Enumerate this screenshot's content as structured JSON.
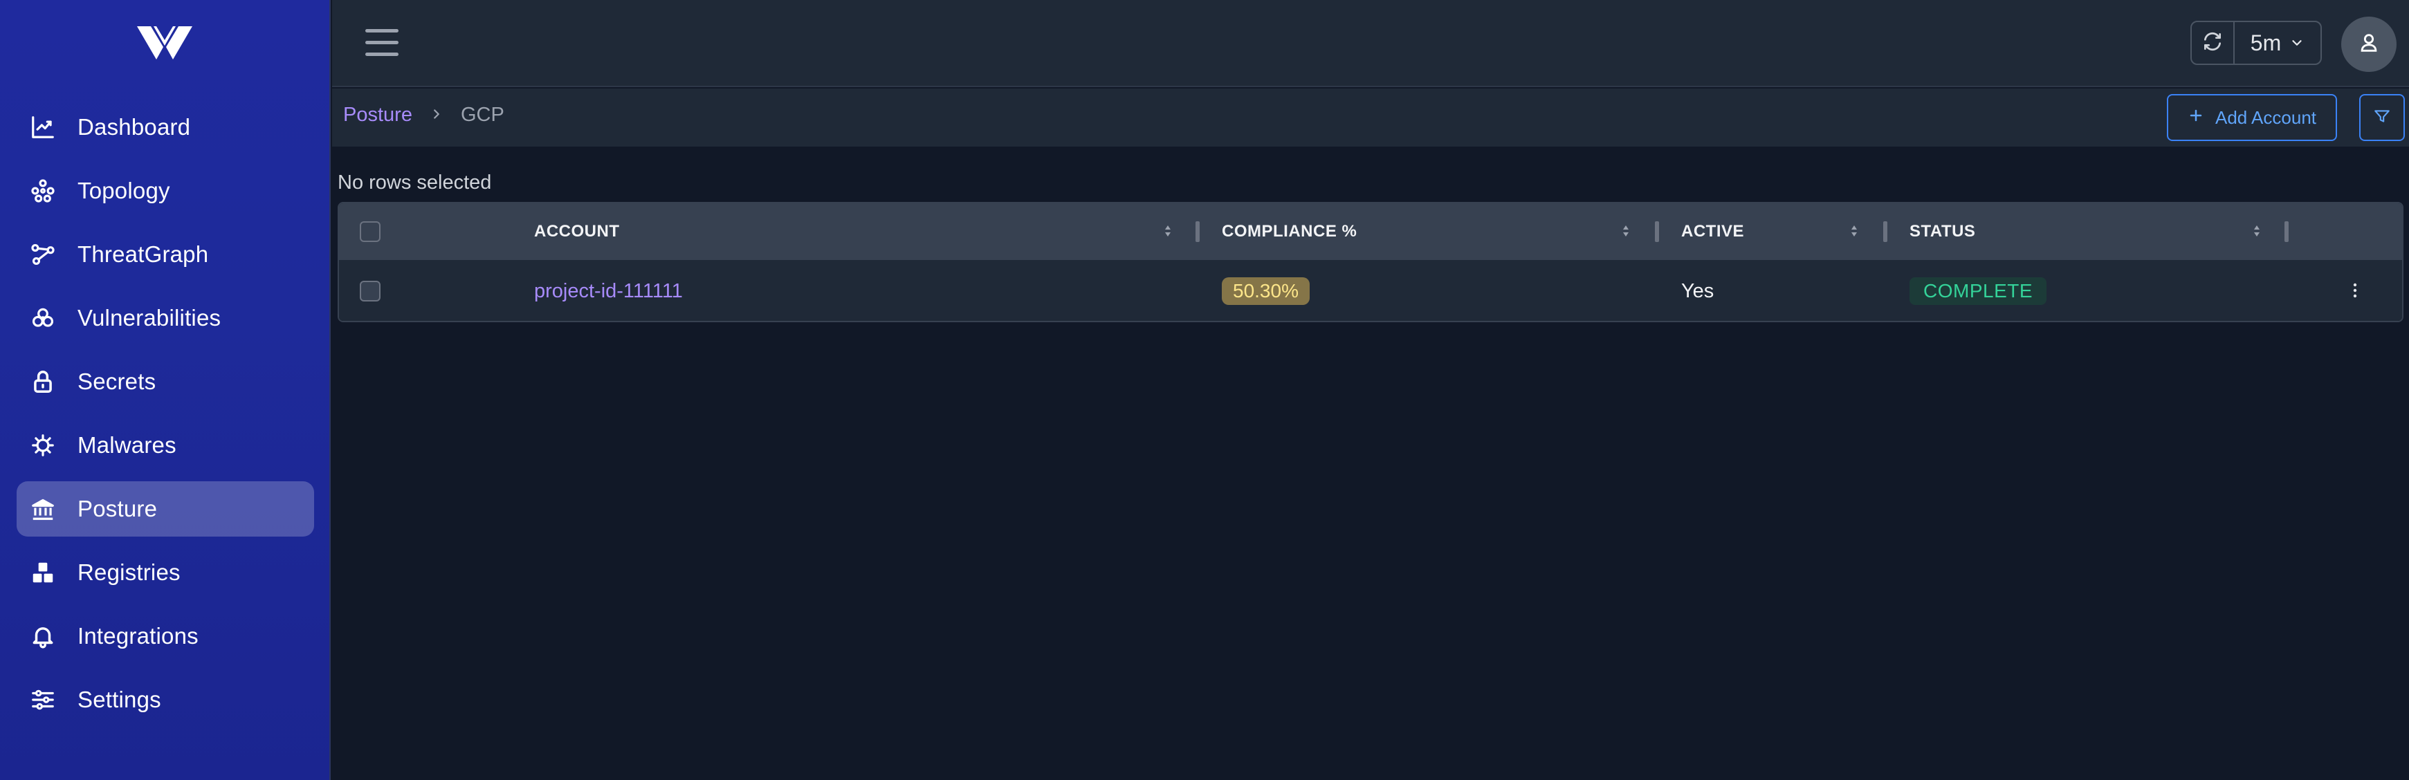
{
  "sidebar": {
    "items": [
      {
        "label": "Dashboard",
        "icon": "chart-line-icon",
        "active": false
      },
      {
        "label": "Topology",
        "icon": "topology-icon",
        "active": false
      },
      {
        "label": "ThreatGraph",
        "icon": "threatgraph-icon",
        "active": false
      },
      {
        "label": "Vulnerabilities",
        "icon": "biohazard-icon",
        "active": false
      },
      {
        "label": "Secrets",
        "icon": "lock-icon",
        "active": false
      },
      {
        "label": "Malwares",
        "icon": "virus-icon",
        "active": false
      },
      {
        "label": "Posture",
        "icon": "bank-icon",
        "active": true
      },
      {
        "label": "Registries",
        "icon": "boxes-icon",
        "active": false
      },
      {
        "label": "Integrations",
        "icon": "bell-icon",
        "active": false
      },
      {
        "label": "Settings",
        "icon": "sliders-icon",
        "active": false
      }
    ]
  },
  "topbar": {
    "refresh_interval": "5m"
  },
  "breadcrumb": {
    "root": "Posture",
    "current": "GCP"
  },
  "actions": {
    "add_account_label": "Add Account"
  },
  "table": {
    "selection_status": "No rows selected",
    "columns": [
      "ACCOUNT",
      "COMPLIANCE %",
      "ACTIVE",
      "STATUS"
    ],
    "rows": [
      {
        "account": "project-id-111111",
        "compliance": "50.30%",
        "active": "Yes",
        "status": "COMPLETE"
      }
    ]
  },
  "colors": {
    "sidebar_bg": "#1f2a9e",
    "page_bg": "#111827",
    "accent_purple": "#a78bfa",
    "accent_blue": "#3b82f6",
    "status_complete": "#34d399",
    "compliance_badge": "#857548"
  }
}
